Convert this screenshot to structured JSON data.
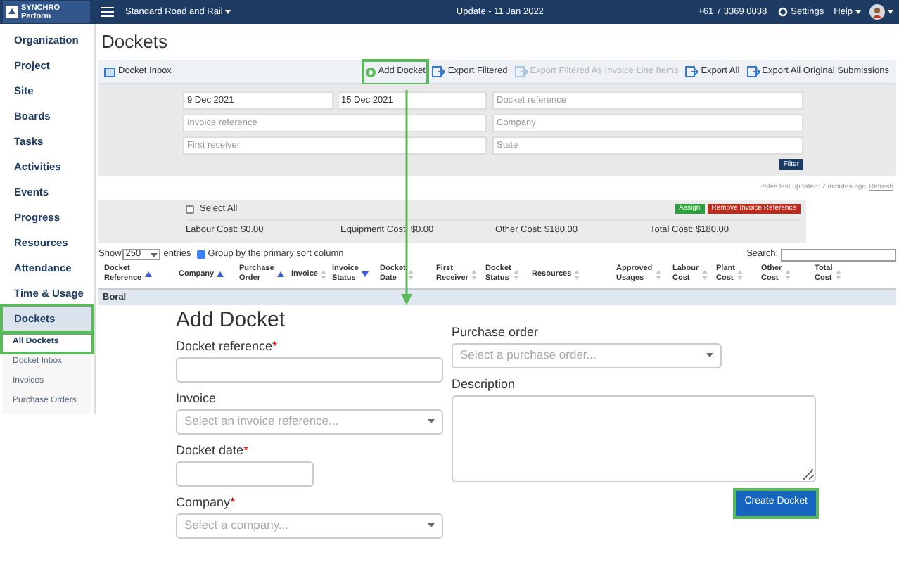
{
  "header": {
    "logo": {
      "brand": "SYNCHRO",
      "product": "Perform"
    },
    "project": "Standard Road and Rail",
    "update": "Update - 11 Jan 2022",
    "phone": "+61 7 3369 0038",
    "settings": "Settings",
    "help": "Help"
  },
  "sidebar": {
    "items": [
      {
        "label": "Organization",
        "selected": false,
        "highlighted": false
      },
      {
        "label": "Project",
        "selected": false,
        "highlighted": false
      },
      {
        "label": "Site",
        "selected": false,
        "highlighted": false
      },
      {
        "label": "Boards",
        "selected": false,
        "highlighted": false
      },
      {
        "label": "Tasks",
        "selected": false,
        "highlighted": false
      },
      {
        "label": "Activities",
        "selected": false,
        "highlighted": false
      },
      {
        "label": "Events",
        "selected": false,
        "highlighted": false
      },
      {
        "label": "Progress",
        "selected": false,
        "highlighted": false
      },
      {
        "label": "Resources",
        "selected": false,
        "highlighted": false
      },
      {
        "label": "Attendance",
        "selected": false,
        "highlighted": false
      },
      {
        "label": "Time & Usage",
        "selected": false,
        "highlighted": false
      },
      {
        "label": "Dockets",
        "selected": true,
        "highlighted": true,
        "children": [
          {
            "label": "All Dockets",
            "selected": true,
            "highlighted": true
          },
          {
            "label": "Docket Inbox",
            "selected": false,
            "highlighted": false
          },
          {
            "label": "Invoices",
            "selected": false,
            "highlighted": false
          },
          {
            "label": "Purchase Orders",
            "selected": false,
            "highlighted": false
          }
        ]
      }
    ]
  },
  "page_title": "Dockets",
  "toolbar": {
    "left": {
      "label": "Docket Inbox"
    },
    "actions": [
      {
        "label": "Add Docket",
        "kind": "add",
        "disabled": false,
        "highlighted": true
      },
      {
        "label": "Export Filtered",
        "kind": "export",
        "disabled": false,
        "highlighted": false
      },
      {
        "label": "Export Filtered As Invoice Line Items",
        "kind": "export",
        "disabled": true,
        "highlighted": false
      },
      {
        "label": "Export All",
        "kind": "export",
        "disabled": false,
        "highlighted": false
      },
      {
        "label": "Export All Original Submissions",
        "kind": "export",
        "disabled": false,
        "highlighted": false
      }
    ]
  },
  "filters": {
    "rows": [
      {
        "left": [
          {
            "value": "9 Dec 2021"
          },
          {
            "value": "15 Dec 2021"
          }
        ],
        "right": {
          "placeholder": "Docket reference"
        }
      },
      {
        "left": [
          {
            "placeholder": "Invoice reference"
          }
        ],
        "right": {
          "placeholder": "Company"
        }
      },
      {
        "left": [
          {
            "placeholder": "First receiver"
          }
        ],
        "right": {
          "placeholder": "State"
        }
      }
    ],
    "button": "Filter"
  },
  "rates": {
    "text": "Rates last updated: 7 minutes ago",
    "link": "Refresh"
  },
  "selection": {
    "select_all": {
      "label": "Select All",
      "checked": false
    },
    "assign": "Assign",
    "remove": "Remove Invoice Reference",
    "costs": [
      "Labour Cost: $0.00",
      "Equipment Cost: $0.00",
      "Other Cost: $180.00",
      "Total Cost: $180.00"
    ]
  },
  "table_controls": {
    "show": "Show",
    "page_size": "250",
    "entries": "entries",
    "group": {
      "label": "Group by the primary sort column",
      "checked": true
    },
    "search": "Search:"
  },
  "table": {
    "columns": [
      {
        "label": "Docket Reference",
        "sorted": true,
        "descending": false
      },
      {
        "label": "Company",
        "sorted": true,
        "descending": false
      },
      {
        "label": "Purchase Order",
        "sorted": true,
        "descending": false
      },
      {
        "label": "Invoice",
        "sorted": false
      },
      {
        "label": "Invoice Status",
        "sorted": true,
        "descending": true
      },
      {
        "label": "Docket Date",
        "sorted": false
      },
      {
        "label": "First Receiver",
        "sorted": false
      },
      {
        "label": "Docket Status",
        "sorted": false
      },
      {
        "label": "Resources",
        "sorted": false
      },
      {
        "label": "Approved Usages",
        "sorted": false
      },
      {
        "label": "Labour Cost",
        "sorted": false
      },
      {
        "label": "Plant Cost",
        "sorted": false
      },
      {
        "label": "Other Cost",
        "sorted": false
      },
      {
        "label": "Total Cost",
        "sorted": false
      }
    ],
    "groups": [
      "Boral"
    ]
  },
  "form": {
    "title": "Add Docket",
    "left": [
      {
        "label": "Docket reference",
        "required_mark": "*",
        "kind": "text"
      },
      {
        "label": "Invoice",
        "kind": "select",
        "placeholder": "Select an invoice reference..."
      },
      {
        "label": "Docket date",
        "required_mark": "*",
        "kind": "date"
      },
      {
        "label": "Company",
        "required_mark": "*",
        "kind": "select",
        "placeholder": "Select a company..."
      }
    ],
    "right": [
      {
        "label": "Purchase order",
        "kind": "select",
        "placeholder": "Select a purchase order..."
      },
      {
        "label": "Description",
        "kind": "textarea"
      }
    ],
    "submit": {
      "label": "Create Docket",
      "highlighted": true
    }
  }
}
